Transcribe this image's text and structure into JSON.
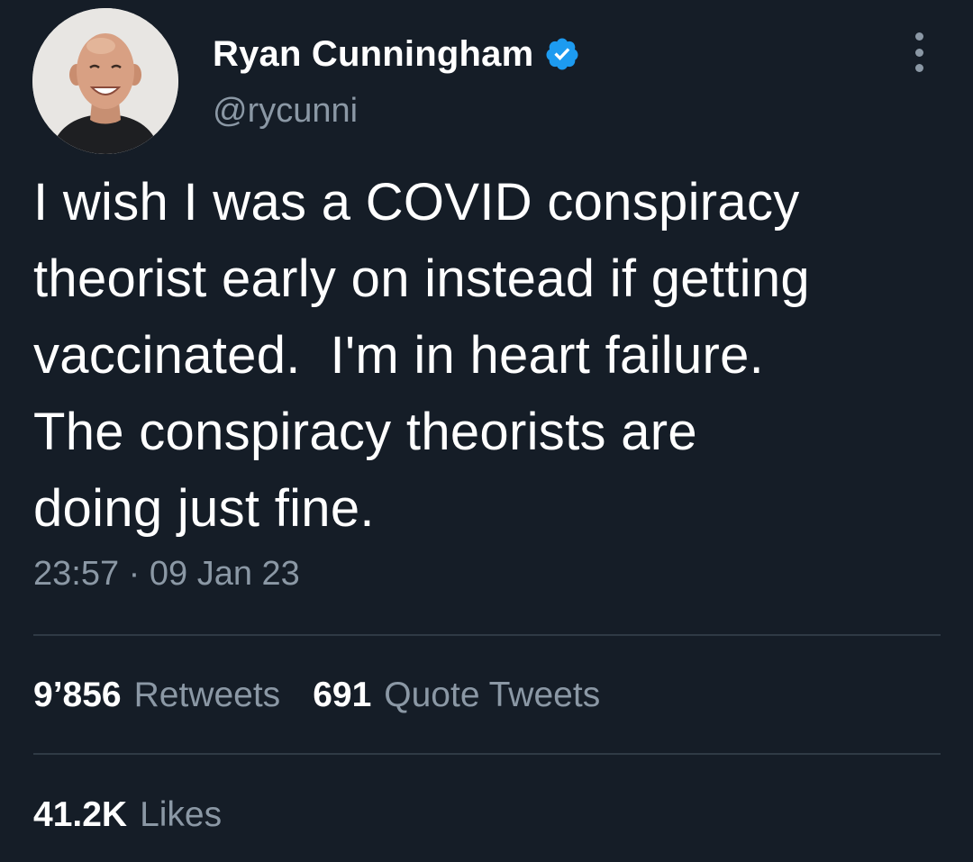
{
  "colors": {
    "background": "#151d27",
    "primary_text": "#ffffff",
    "secondary_text": "#8b98a5",
    "divider": "#2f3a45",
    "verified_badge": "#1d9bf0"
  },
  "author": {
    "display_name": "Ryan Cunningham",
    "handle": "@rycunni",
    "verified_icon": "verified-badge-icon",
    "avatar_icon": "user-avatar"
  },
  "tweet": {
    "text": "I wish I was a COVID conspiracy\ntheorist early on instead if getting\nvaccinated.  I'm in heart failure.\nThe conspiracy theorists are\ndoing just fine.",
    "time": "23:57",
    "separator": "·",
    "date": "09 Jan 23"
  },
  "stats": {
    "retweets": {
      "count": "9’856",
      "label": "Retweets"
    },
    "quote_tweets": {
      "count": "691",
      "label": "Quote Tweets"
    },
    "likes": {
      "count": "41.2K",
      "label": "Likes"
    }
  },
  "menu": {
    "icon": "more-options-icon"
  }
}
